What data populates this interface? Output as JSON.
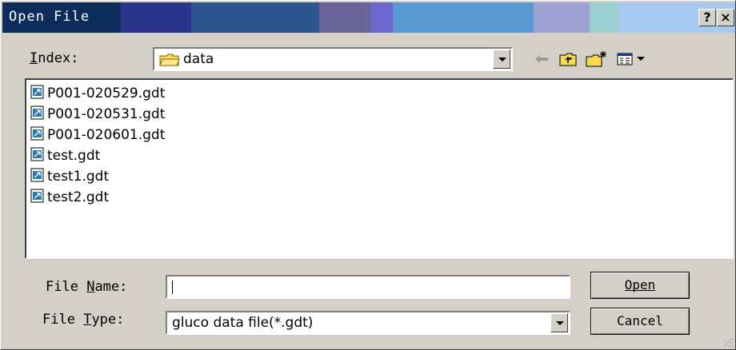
{
  "window": {
    "title": "Open File",
    "help_label": "?",
    "close_label": "×"
  },
  "index": {
    "label": "Index:",
    "folder": "data"
  },
  "files": [
    "P001-020529.gdt",
    "P001-020531.gdt",
    "P001-020601.gdt",
    "test.gdt",
    "test1.gdt",
    "test2.gdt"
  ],
  "file_name": {
    "label": "File Name:",
    "value": ""
  },
  "file_type": {
    "label": "File Type:",
    "value": "gluco data file(*.gdt)"
  },
  "buttons": {
    "open": "Open",
    "cancel": "Cancel"
  },
  "colors": {
    "title_bar": [
      "#0b2a5e",
      "#283a8c",
      "#2e4f98",
      "#3a6aa8",
      "#6a62a0",
      "#6666cc",
      "#5b9bd5",
      "#9ba0d0",
      "#9bd0d0",
      "#a8c8f0"
    ]
  }
}
